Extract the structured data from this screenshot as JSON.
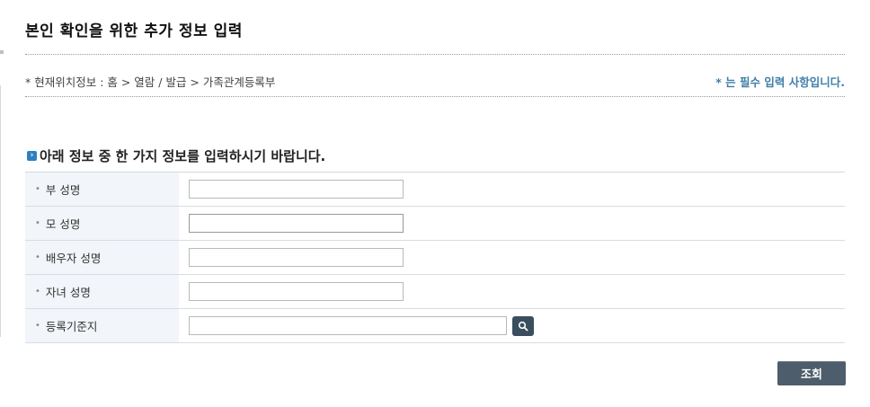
{
  "page_title": "본인 확인을 위한 추가 정보 입력",
  "breadcrumb": "* 현재위치정보 : 홈 > 열람 / 발급 > 가족관계등록부",
  "required_note": "* 는 필수 입력 사항입니다.",
  "section_title": "아래 정보 중 한 가지 정보를 입력하시기 바랍니다.",
  "form": {
    "rows": [
      {
        "label": "부 성명",
        "value": ""
      },
      {
        "label": "모 성명",
        "value": ""
      },
      {
        "label": "배우자 성명",
        "value": ""
      },
      {
        "label": "자녀 성명",
        "value": ""
      },
      {
        "label": "등록기준지",
        "value": ""
      }
    ]
  },
  "buttons": {
    "submit_label": "조회"
  },
  "icons": {
    "section_marker": "arrow-right-icon",
    "search": "search-icon"
  },
  "colors": {
    "accent": "#3f7fa8",
    "button": "#4d5d6b",
    "label_bg": "#f2f5f9"
  }
}
